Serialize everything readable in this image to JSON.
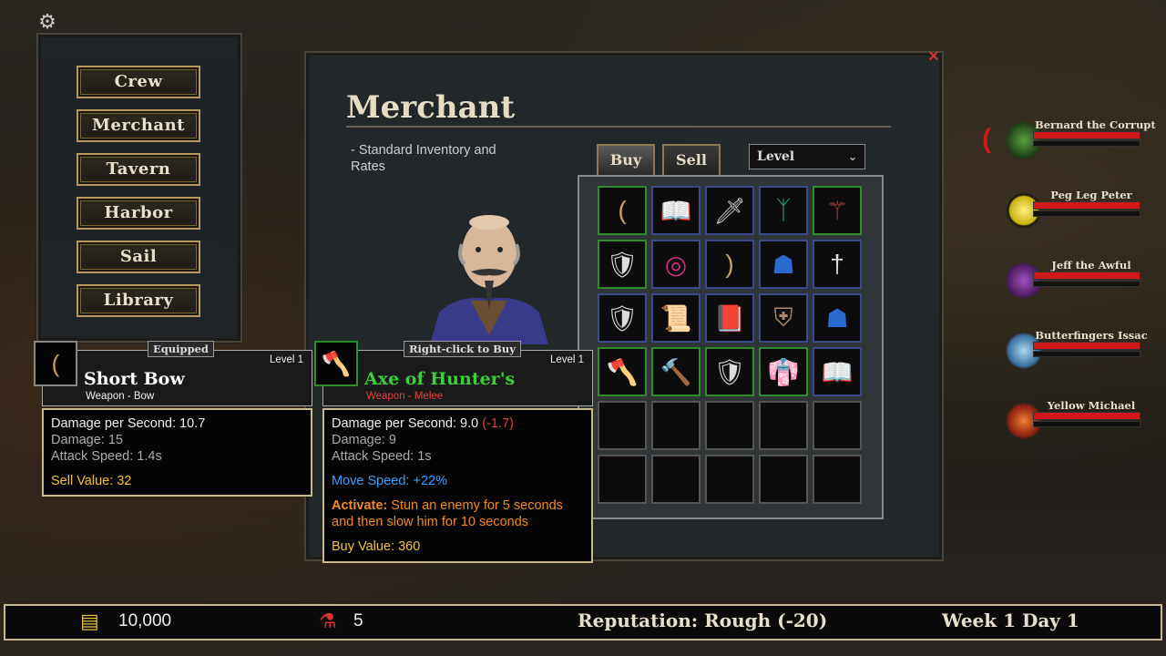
{
  "nav": {
    "items": [
      {
        "label": "Crew"
      },
      {
        "label": "Merchant"
      },
      {
        "label": "Tavern"
      },
      {
        "label": "Harbor"
      },
      {
        "label": "Sail"
      },
      {
        "label": "Library"
      }
    ]
  },
  "merchant": {
    "title": "Merchant",
    "description": "- Standard Inventory and Rates",
    "tabs": {
      "buy": "Buy",
      "sell": "Sell"
    },
    "sort": {
      "selected": "Level"
    }
  },
  "inventory": {
    "slots": [
      {
        "icon": "bow-icon",
        "glyph": "(",
        "rarity": "green"
      },
      {
        "icon": "spellbook-icon",
        "glyph": "📖",
        "rarity": "blue"
      },
      {
        "icon": "sword-icon",
        "glyph": "🗡",
        "rarity": "blue"
      },
      {
        "icon": "tentacle-helm-icon",
        "glyph": "ᛉ",
        "rarity": "blue"
      },
      {
        "icon": "staff-icon",
        "glyph": "⚚",
        "rarity": "green"
      },
      {
        "icon": "armor-icon",
        "glyph": "🛡",
        "rarity": "green"
      },
      {
        "icon": "amulet-icon",
        "glyph": "◎",
        "rarity": "blue"
      },
      {
        "icon": "bow-icon",
        "glyph": ")",
        "rarity": "blue"
      },
      {
        "icon": "hood-icon",
        "glyph": "☗",
        "rarity": "blue"
      },
      {
        "icon": "dagger-icon",
        "glyph": "†",
        "rarity": "blue"
      },
      {
        "icon": "armor-icon",
        "glyph": "🛡",
        "rarity": "blue"
      },
      {
        "icon": "scroll-icon",
        "glyph": "📜",
        "rarity": "blue"
      },
      {
        "icon": "tome-icon",
        "glyph": "📕",
        "rarity": "blue"
      },
      {
        "icon": "shield-icon",
        "glyph": "⛨",
        "rarity": "blue"
      },
      {
        "icon": "hood-icon",
        "glyph": "☗",
        "rarity": "blue"
      },
      {
        "icon": "axe-icon",
        "glyph": "🪓",
        "rarity": "green"
      },
      {
        "icon": "hammer-icon",
        "glyph": "🔨",
        "rarity": "green"
      },
      {
        "icon": "armor-icon",
        "glyph": "🛡",
        "rarity": "green"
      },
      {
        "icon": "robe-icon",
        "glyph": "👘",
        "rarity": "green"
      },
      {
        "icon": "spellbook-icon",
        "glyph": "📖",
        "rarity": "blue"
      },
      {
        "icon": "",
        "glyph": "",
        "rarity": "empty"
      },
      {
        "icon": "",
        "glyph": "",
        "rarity": "empty"
      },
      {
        "icon": "",
        "glyph": "",
        "rarity": "empty"
      },
      {
        "icon": "",
        "glyph": "",
        "rarity": "empty"
      },
      {
        "icon": "",
        "glyph": "",
        "rarity": "empty"
      },
      {
        "icon": "",
        "glyph": "",
        "rarity": "empty"
      },
      {
        "icon": "",
        "glyph": "",
        "rarity": "empty"
      },
      {
        "icon": "",
        "glyph": "",
        "rarity": "empty"
      },
      {
        "icon": "",
        "glyph": "",
        "rarity": "empty"
      },
      {
        "icon": "",
        "glyph": "",
        "rarity": "empty"
      }
    ]
  },
  "equipped_item": {
    "badge": "Equipped",
    "level": "Level 1",
    "name": "Short Bow",
    "type": "Weapon - Bow",
    "stats": {
      "dps": "Damage per Second: 10.7",
      "damage": "Damage: 15",
      "attack_speed": "Attack Speed: 1.4s"
    },
    "value": "Sell Value: 32"
  },
  "hovered_item": {
    "badge": "Right-click to Buy",
    "level": "Level 1",
    "name": "Axe of Hunter's",
    "type": "Weapon - Melee",
    "stats": {
      "dps": "Damage per Second: 9.0",
      "dps_diff": "(-1.7)",
      "damage": "Damage: 9",
      "attack_speed": "Attack Speed: 1s"
    },
    "bonus": "Move Speed: +22%",
    "activate_label": "Activate:",
    "activate_text": "Stun an enemy for 5 seconds and then slow him for 10 seconds",
    "value": "Buy Value: 360"
  },
  "crew": [
    {
      "name": "Bernard the Corrupt",
      "crest": "green-splatter-crest-icon",
      "color": "#2e8b2e",
      "hp": 1.0
    },
    {
      "name": "Peg Leg Peter",
      "crest": "yellow-cross-crest-icon",
      "color": "#e6d020",
      "hp": 1.0
    },
    {
      "name": "Jeff the Awful",
      "crest": "purple-cross-crest-icon",
      "color": "#7a3a9a",
      "hp": 1.0
    },
    {
      "name": "Butterfingers Issac",
      "crest": "wave-crest-icon",
      "color": "#4a8ac0",
      "hp": 1.0
    },
    {
      "name": "Yellow Michael",
      "crest": "flame-crest-icon",
      "color": "#c04020",
      "hp": 1.0
    }
  ],
  "status": {
    "gold": "10,000",
    "potions": "5",
    "reputation": "Reputation: Rough (-20)",
    "date": "Week 1 Day 1"
  }
}
